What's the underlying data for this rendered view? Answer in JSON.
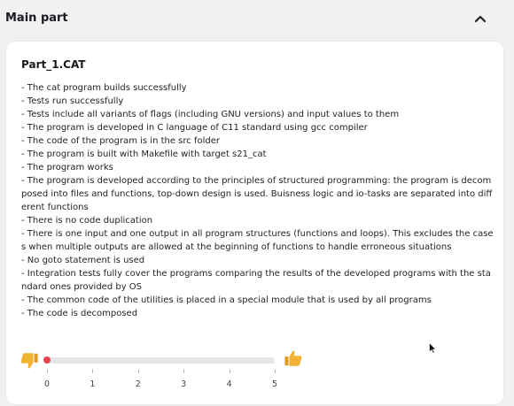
{
  "section": {
    "title": "Main part",
    "toggle_icon": "chevron-up-icon"
  },
  "card": {
    "title": "Part_1.CAT",
    "criteria": [
      "- The cat program builds successfully",
      "- Tests run successfully",
      "- Tests include all variants of flags (including GNU versions) and input values to them",
      "- The program is developed in C language of C11 standard using gcc compiler",
      "- The code of the program is in the src folder",
      "- The program is built with Makefile with target s21_cat",
      "- The program works",
      "- The program is developed according to the principles of structured programming: the program is decomposed into files and functions, top-down design is used. Buisness logic and io-tasks are separated into different functions",
      "- There is no code duplication",
      "- There is one input and one output in all program structures (functions and loops). This excludes the cases when multiple outputs are allowed at the beginning of functions to handle erroneous situations",
      "- No goto statement is used",
      "- Integration tests fully cover the programs comparing the results of the developed programs with the standard ones provided by OS",
      "- The common code of the utilities is placed in a special module that is used by all programs",
      "- The code is decomposed"
    ]
  },
  "rating": {
    "min": 0,
    "max": 5,
    "value": 0,
    "ticks": [
      "0",
      "1",
      "2",
      "3",
      "4",
      "5"
    ],
    "down_icon": "thumbs-down-icon",
    "up_icon": "thumbs-up-icon",
    "colors": {
      "handle": "#e8414b",
      "track": "#e6e6ea",
      "thumbs": "#f2b233"
    }
  }
}
